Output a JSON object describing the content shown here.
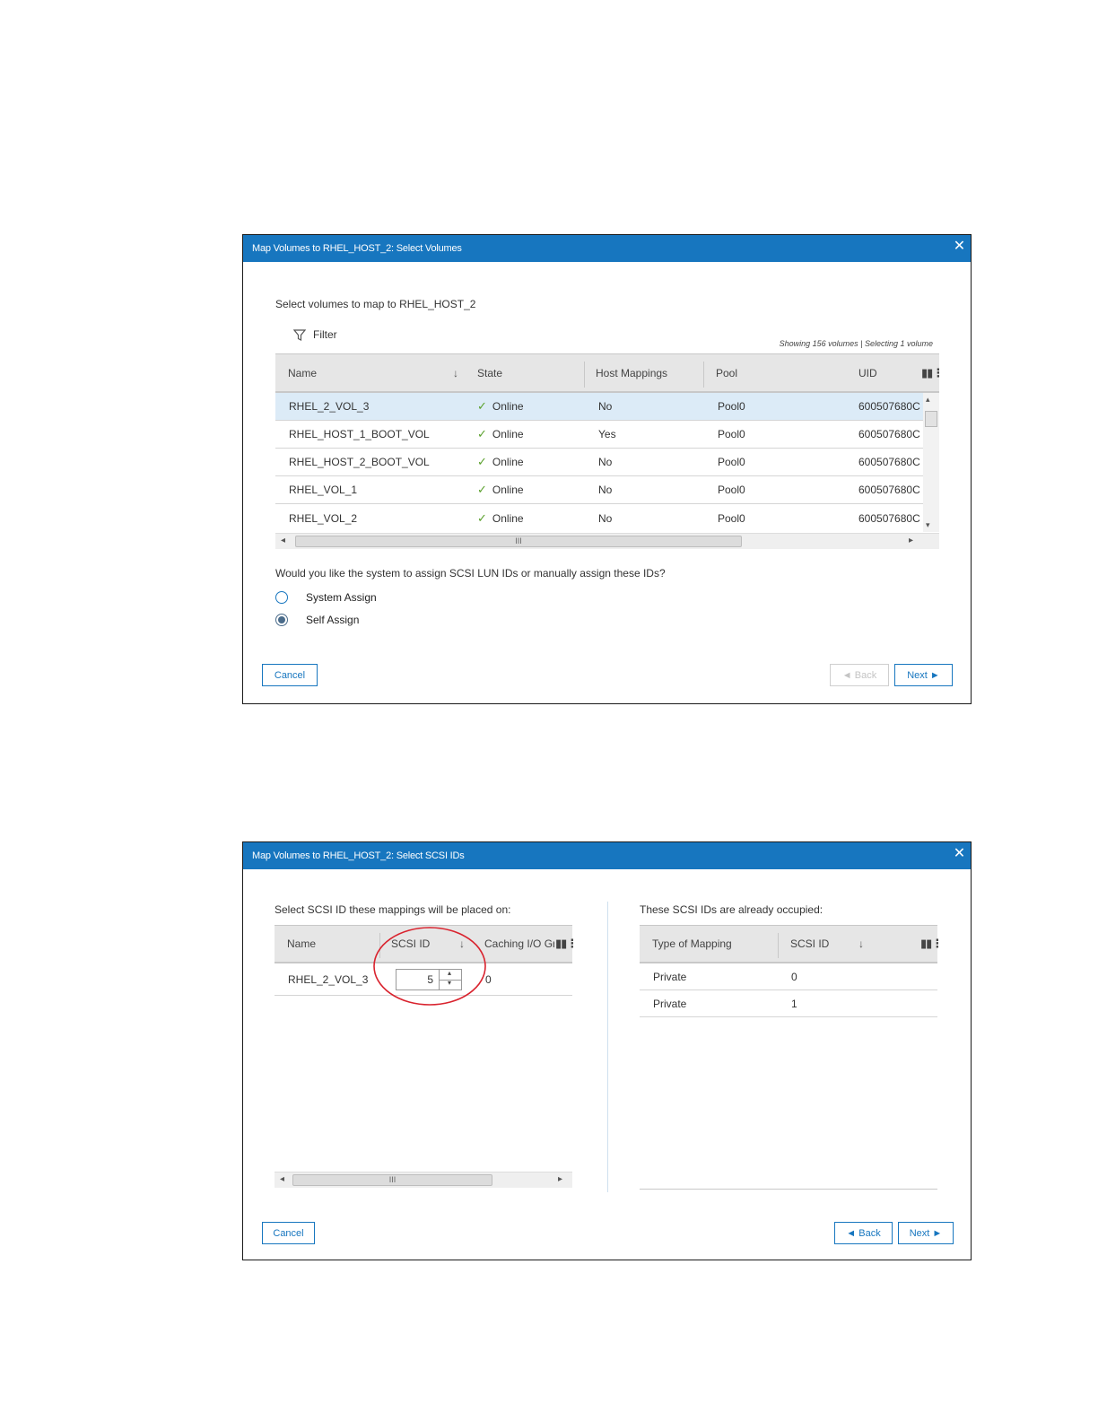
{
  "dialog1": {
    "title": "Map Volumes to RHEL_HOST_2: Select Volumes",
    "close": "✕",
    "instruction": "Select volumes to map to RHEL_HOST_2",
    "filter_label": "Filter",
    "status_text": "Showing 156 volumes | Selecting 1 volume",
    "columns": [
      "Name",
      "State",
      "Host Mappings",
      "Pool",
      "UID"
    ],
    "rows": [
      {
        "name": "RHEL_2_VOL_3",
        "state": "Online",
        "host_mappings": "No",
        "pool": "Pool0",
        "uid": "600507680C"
      },
      {
        "name": "RHEL_HOST_1_BOOT_VOL",
        "state": "Online",
        "host_mappings": "Yes",
        "pool": "Pool0",
        "uid": "600507680C"
      },
      {
        "name": "RHEL_HOST_2_BOOT_VOL",
        "state": "Online",
        "host_mappings": "No",
        "pool": "Pool0",
        "uid": "600507680C"
      },
      {
        "name": "RHEL_VOL_1",
        "state": "Online",
        "host_mappings": "No",
        "pool": "Pool0",
        "uid": "600507680C"
      },
      {
        "name": "RHEL_VOL_2",
        "state": "Online",
        "host_mappings": "No",
        "pool": "Pool0",
        "uid": "600507680C"
      }
    ],
    "question": "Would you like the system to assign SCSI LUN IDs or manually assign these IDs?",
    "options": [
      "System Assign",
      "Self Assign"
    ],
    "selected_option": "Self Assign",
    "cancel_label": "Cancel",
    "back_label": "◄ Back",
    "next_label": "Next ►"
  },
  "dialog2": {
    "title": "Map Volumes to RHEL_HOST_2: Select SCSI IDs",
    "close": "✕",
    "left_heading": "Select SCSI ID these mappings will be placed on:",
    "left_columns": [
      "Name",
      "SCSI ID",
      "Caching I/O Gr"
    ],
    "left_rows": [
      {
        "name": "RHEL_2_VOL_3",
        "scsi_id": "5",
        "caching_io_group": "0"
      }
    ],
    "right_heading": "These SCSI IDs are already occupied:",
    "right_columns": [
      "Type of Mapping",
      "SCSI ID"
    ],
    "right_rows": [
      {
        "type": "Private",
        "scsi_id": "0"
      },
      {
        "type": "Private",
        "scsi_id": "1"
      }
    ],
    "cancel_label": "Cancel",
    "back_label": "◄ Back",
    "next_label": "Next ►"
  },
  "icons": {
    "sort_down": "↓",
    "column_config": "▮▮⋮",
    "checkmark": "✓",
    "scroll_left": "◂",
    "scroll_right": "▸",
    "scroll_up": "▴",
    "scroll_down": "▾",
    "thumb_grip": "III",
    "spin_up": "▴",
    "spin_down": "▾"
  },
  "colors": {
    "titlebar": "#1776bf",
    "selected_row": "#dcebf7",
    "online_check": "#5aa02c",
    "highlight_circle": "#d9232e"
  }
}
